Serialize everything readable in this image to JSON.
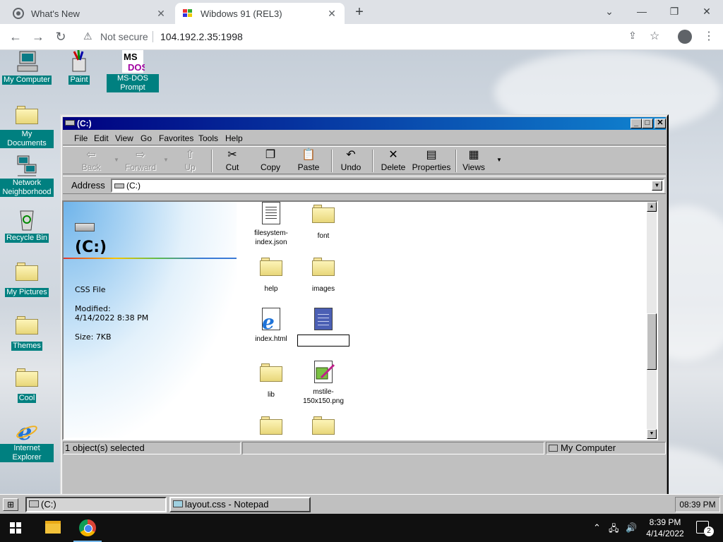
{
  "browser": {
    "tabs": [
      {
        "title": "What's New",
        "active": false
      },
      {
        "title": "Wibdows 91 (REL3)",
        "active": true
      }
    ],
    "security_label": "Not secure",
    "url": "104.192.2.35:1998"
  },
  "desktop": {
    "icons": [
      {
        "label": "My Computer",
        "icon": "computer-icon"
      },
      {
        "label": "Paint",
        "icon": "paint-icon"
      },
      {
        "label": "MS-DOS Prompt",
        "icon": "msdos-icon"
      },
      {
        "label": "My Documents",
        "icon": "folder-icon"
      },
      {
        "label": "Network Neighborhood",
        "icon": "network-icon"
      },
      {
        "label": "Recycle Bin",
        "icon": "recycle-bin-icon"
      },
      {
        "label": "My Pictures",
        "icon": "folder-icon"
      },
      {
        "label": "Themes",
        "icon": "folder-icon"
      },
      {
        "label": "Cool",
        "icon": "folder-icon"
      },
      {
        "label": "Internet Explorer",
        "icon": "ie-icon"
      }
    ]
  },
  "explorer": {
    "title": "(C:)",
    "menu": [
      "File",
      "Edit",
      "View",
      "Go",
      "Favorites",
      "Tools",
      "Help"
    ],
    "toolbar": {
      "back": "Back",
      "forward": "Forward",
      "up": "Up",
      "cut": "Cut",
      "copy": "Copy",
      "paste": "Paste",
      "undo": "Undo",
      "delete": "Delete",
      "properties": "Properties",
      "views": "Views"
    },
    "address_label": "Address",
    "address_value": "(C:)",
    "info": {
      "title": "(C:)",
      "type": "CSS File",
      "modified_label": "Modified:",
      "modified_value": "4/14/2022 8:38 PM",
      "size": "Size: 7KB"
    },
    "files": [
      {
        "name": "filesystem-index.json",
        "icon": "document-icon"
      },
      {
        "name": "font",
        "icon": "folder-icon"
      },
      {
        "name": "help",
        "icon": "folder-icon"
      },
      {
        "name": "images",
        "icon": "folder-icon"
      },
      {
        "name": "index.html",
        "icon": "ie-document-icon"
      },
      {
        "name": "",
        "icon": "notepad-icon",
        "renaming": true
      },
      {
        "name": "lib",
        "icon": "folder-icon"
      },
      {
        "name": "mstile-150x150.png",
        "icon": "image-file-icon"
      },
      {
        "name": "",
        "icon": "folder-icon"
      },
      {
        "name": "",
        "icon": "folder-icon"
      }
    ],
    "status": {
      "selected": "1 object(s) selected",
      "location": "My Computer"
    }
  },
  "w98taskbar": {
    "items": [
      {
        "label": "(C:)",
        "pressed": true
      },
      {
        "label": "layout.css - Notepad",
        "pressed": false
      }
    ],
    "clock": "08:39 PM"
  },
  "w10taskbar": {
    "time": "8:39 PM",
    "date": "4/14/2022",
    "notifications": "2"
  }
}
